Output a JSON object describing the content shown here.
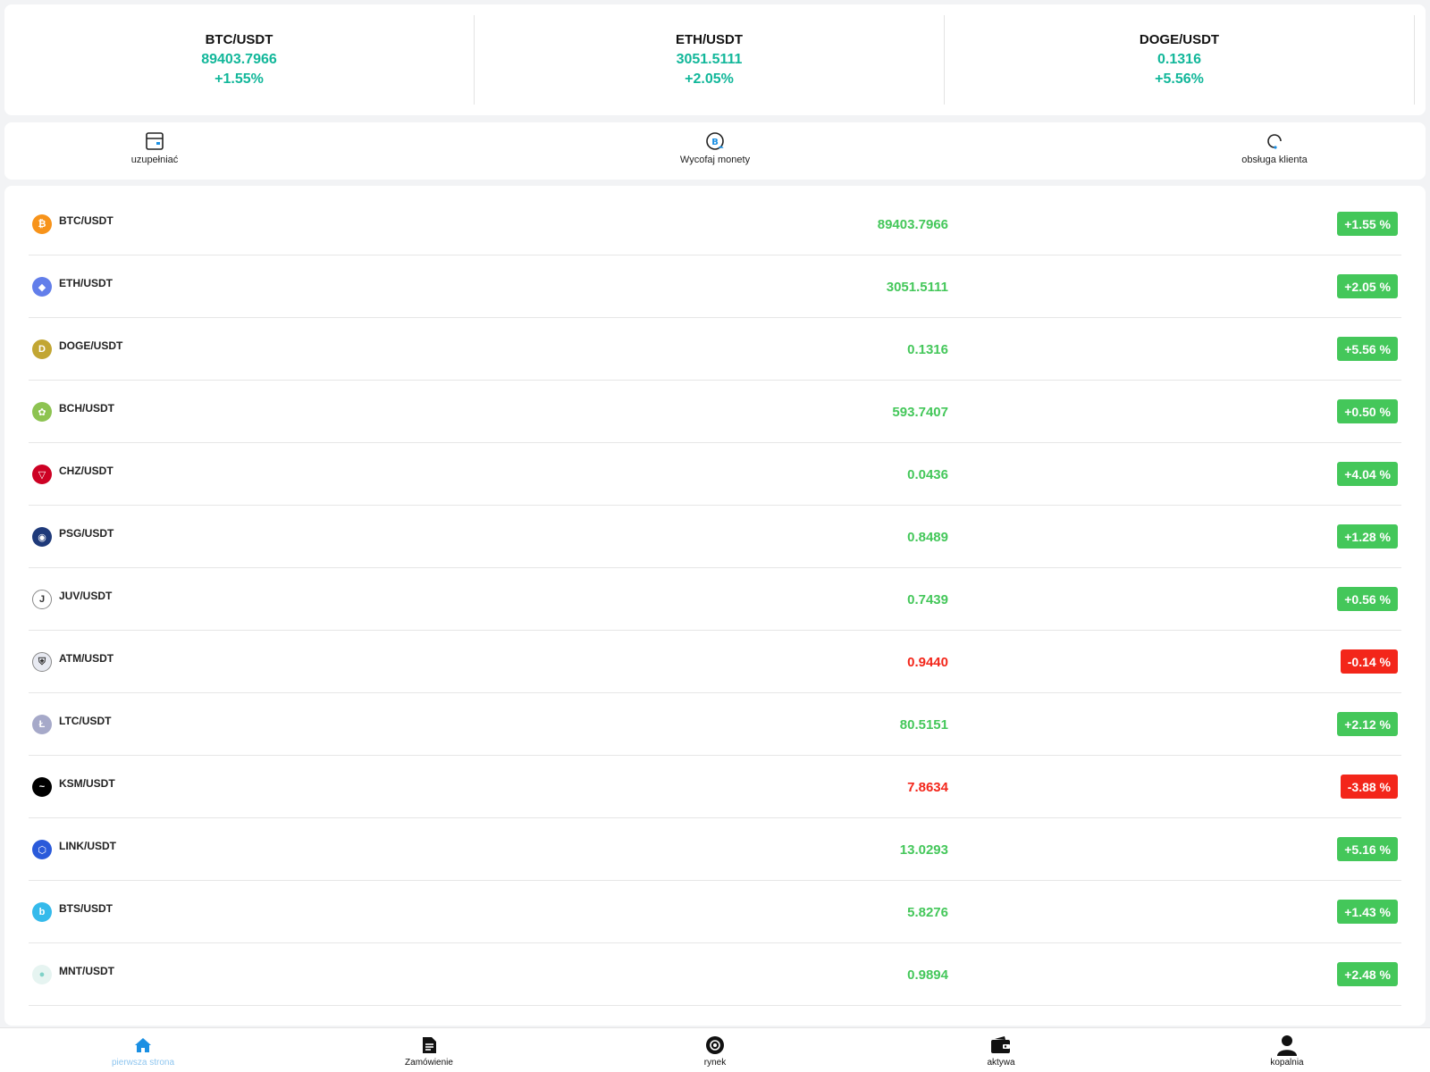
{
  "tickers": [
    {
      "symbol": "BTC/USDT",
      "price": "89403.7966",
      "change": "+1.55%"
    },
    {
      "symbol": "ETH/USDT",
      "price": "3051.5111",
      "change": "+2.05%"
    },
    {
      "symbol": "DOGE/USDT",
      "price": "0.1316",
      "change": "+5.56%"
    }
  ],
  "actions": {
    "deposit": {
      "label": "uzupełniać",
      "icon": "wallet-card-icon"
    },
    "withdraw": {
      "label": "Wycofaj monety",
      "icon": "coin-withdraw-icon"
    },
    "support": {
      "label": "obsługa klienta",
      "icon": "headset-icon"
    }
  },
  "market": [
    {
      "symbol": "BTC/USDT",
      "price": "89403.7966",
      "change": "+1.55 %",
      "color": "#f7931a",
      "glyph": "₿",
      "up": true
    },
    {
      "symbol": "ETH/USDT",
      "price": "3051.5111",
      "change": "+2.05 %",
      "color": "#627eea",
      "glyph": "◆",
      "up": true
    },
    {
      "symbol": "DOGE/USDT",
      "price": "0.1316",
      "change": "+5.56 %",
      "color": "#c2a633",
      "glyph": "D",
      "up": true
    },
    {
      "symbol": "BCH/USDT",
      "price": "593.7407",
      "change": "+0.50 %",
      "color": "#8dc351",
      "glyph": "✿",
      "up": true
    },
    {
      "symbol": "CHZ/USDT",
      "price": "0.0436",
      "change": "+4.04 %",
      "color": "#cd0124",
      "glyph": "▽",
      "up": true
    },
    {
      "symbol": "PSG/USDT",
      "price": "0.8489",
      "change": "+1.28 %",
      "color": "#1f3a7a",
      "glyph": "◉",
      "up": true
    },
    {
      "symbol": "JUV/USDT",
      "price": "0.7439",
      "change": "+0.56 %",
      "color": "#ffffff",
      "glyph": "J",
      "up": true
    },
    {
      "symbol": "ATM/USDT",
      "price": "0.9440",
      "change": "-0.14 %",
      "color": "#e8eaf2",
      "glyph": "⛨",
      "up": false
    },
    {
      "symbol": "LTC/USDT",
      "price": "80.5151",
      "change": "+2.12 %",
      "color": "#a6a9c9",
      "glyph": "Ł",
      "up": true
    },
    {
      "symbol": "KSM/USDT",
      "price": "7.8634",
      "change": "-3.88 %",
      "color": "#000000",
      "glyph": "~",
      "up": false
    },
    {
      "symbol": "LINK/USDT",
      "price": "13.0293",
      "change": "+5.16 %",
      "color": "#2a5ada",
      "glyph": "⬡",
      "up": true
    },
    {
      "symbol": "BTS/USDT",
      "price": "5.8276",
      "change": "+1.43 %",
      "color": "#35baeb",
      "glyph": "b",
      "up": true
    },
    {
      "symbol": "MNT/USDT",
      "price": "0.9894",
      "change": "+2.48 %",
      "color": "#e6f4f1",
      "glyph": "●",
      "up": true
    }
  ],
  "colors": {
    "up": "#44c75a",
    "down": "#f3261a",
    "ticker": "#12b79a",
    "nav_active": "#1a8fe3"
  },
  "bottom_nav": [
    {
      "label": "pierwsza strona",
      "icon": "home-icon",
      "active": true
    },
    {
      "label": "Zamówienie",
      "icon": "document-icon",
      "active": false
    },
    {
      "label": "rynek",
      "icon": "market-icon",
      "active": false
    },
    {
      "label": "aktywa",
      "icon": "wallet-icon",
      "active": false
    },
    {
      "label": "kopalnia",
      "icon": "user-icon",
      "active": false
    }
  ]
}
